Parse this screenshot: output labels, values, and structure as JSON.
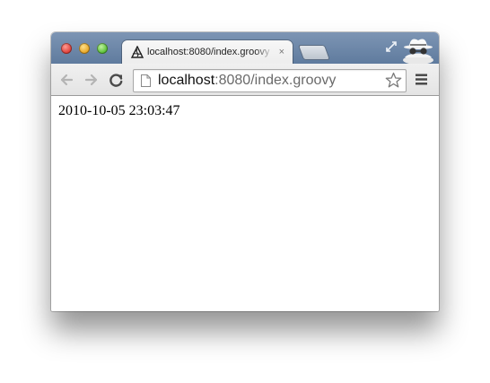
{
  "tab": {
    "title": "localhost:8080/index.groovy",
    "close_glyph": "×",
    "favicon": "groovy-logo-icon"
  },
  "toolbar": {
    "back_icon": "back-arrow-icon",
    "forward_icon": "forward-arrow-icon",
    "reload_icon": "reload-icon",
    "menu_icon": "menu-icon"
  },
  "omnibox": {
    "host": "localhost",
    "rest": ":8080/index.groovy",
    "page_icon": "page-icon",
    "bookmark_icon": "star-icon"
  },
  "page": {
    "text": "2010-10-05 23:03:47"
  },
  "window": {
    "incognito_icon": "incognito-icon",
    "fullscreen_icon": "fullscreen-icon"
  },
  "colors": {
    "titlebar": "#6e88aa",
    "tab": "#f3f3f3",
    "toolbar": "#eaeaea"
  }
}
